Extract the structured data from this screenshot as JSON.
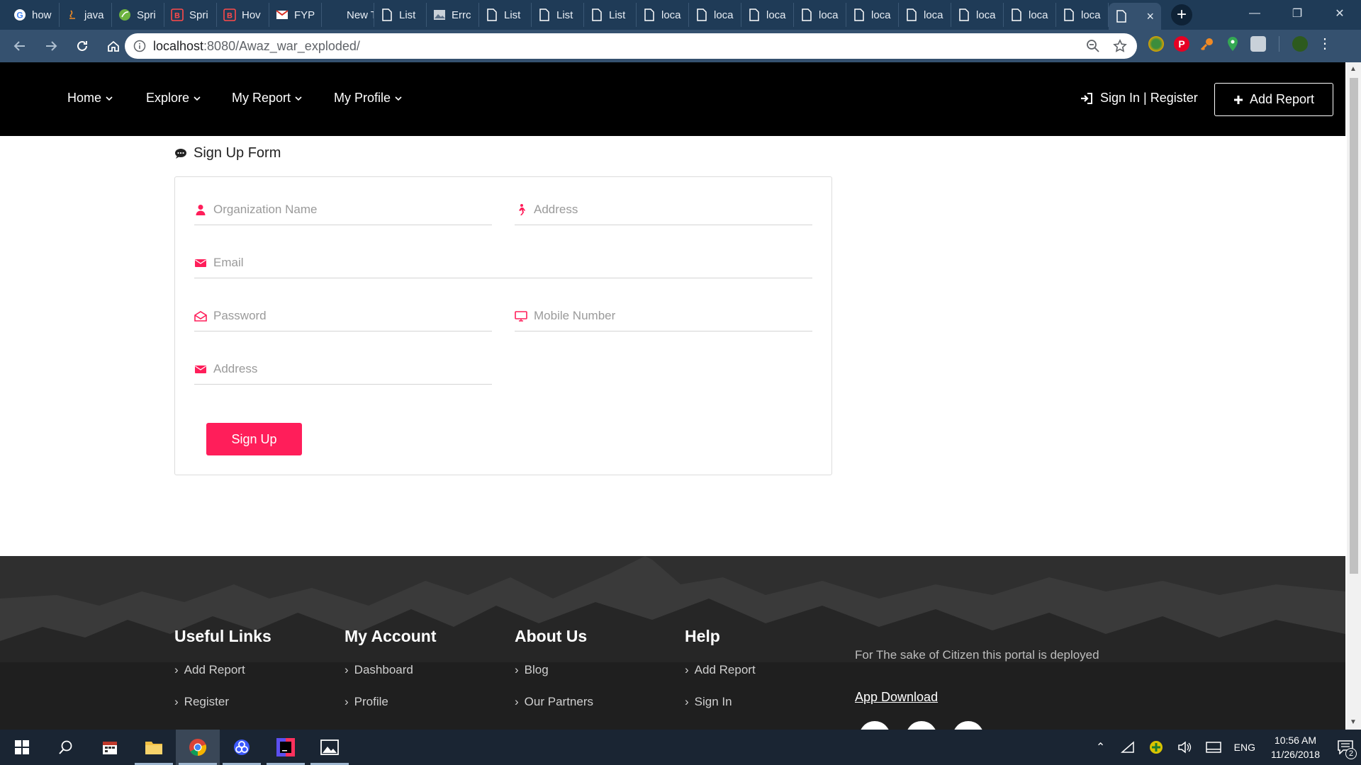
{
  "browser": {
    "tabs": [
      {
        "label": "how",
        "icon": "google-icon"
      },
      {
        "label": "java",
        "icon": "java-icon"
      },
      {
        "label": "Spri",
        "icon": "spring-icon"
      },
      {
        "label": "Spri",
        "icon": "bootstrap-icon"
      },
      {
        "label": "Hov",
        "icon": "bootstrap-icon"
      },
      {
        "label": "FYP",
        "icon": "gmail-icon"
      },
      {
        "label": "New Tal",
        "icon": "none"
      },
      {
        "label": "List",
        "icon": "page-icon"
      },
      {
        "label": "Errc",
        "icon": "image-icon"
      },
      {
        "label": "List",
        "icon": "page-icon"
      },
      {
        "label": "List",
        "icon": "page-icon"
      },
      {
        "label": "List",
        "icon": "page-icon"
      },
      {
        "label": "loca",
        "icon": "page-icon"
      },
      {
        "label": "loca",
        "icon": "page-icon"
      },
      {
        "label": "loca",
        "icon": "page-icon"
      },
      {
        "label": "loca",
        "icon": "page-icon"
      },
      {
        "label": "loca",
        "icon": "page-icon"
      },
      {
        "label": "loca",
        "icon": "page-icon"
      },
      {
        "label": "loca",
        "icon": "page-icon"
      },
      {
        "label": "loca",
        "icon": "page-icon"
      },
      {
        "label": "loca",
        "icon": "page-icon"
      }
    ],
    "active_tab_close": "×",
    "new_tab": "+",
    "url_host": "localhost",
    "url_path": ":8080/Awaz_war_exploded/"
  },
  "site": {
    "nav": {
      "home": "Home",
      "explore": "Explore",
      "my_report": "My Report",
      "my_profile": "My Profile",
      "sign_in": "Sign In | Register",
      "add_report": "Add Report"
    },
    "form": {
      "title": "Sign Up Form",
      "org_name_placeholder": "Organization Name",
      "address_placeholder": "Address",
      "email_placeholder": "Email",
      "password_placeholder": "Password",
      "mobile_placeholder": "Mobile Number",
      "address2_placeholder": "Address",
      "submit": "Sign Up"
    },
    "footer": {
      "useful_links": {
        "title": "Useful Links",
        "items": [
          "Add Report",
          "Register"
        ]
      },
      "my_account": {
        "title": "My Account",
        "items": [
          "Dashboard",
          "Profile"
        ]
      },
      "about_us": {
        "title": "About Us",
        "items": [
          "Blog",
          "Our Partners"
        ]
      },
      "help": {
        "title": "Help",
        "items": [
          "Add Report",
          "Sign In"
        ]
      },
      "tagline": "For The sake of Citizen this portal is deployed",
      "app_download": "App Download"
    }
  },
  "taskbar": {
    "language": "ENG",
    "time": "10:56 AM",
    "date": "11/26/2018",
    "notification_count": "2"
  },
  "colors": {
    "accent": "#ff1e5a",
    "nav_bg": "#000000",
    "chrome_frame": "#1f3b57"
  }
}
